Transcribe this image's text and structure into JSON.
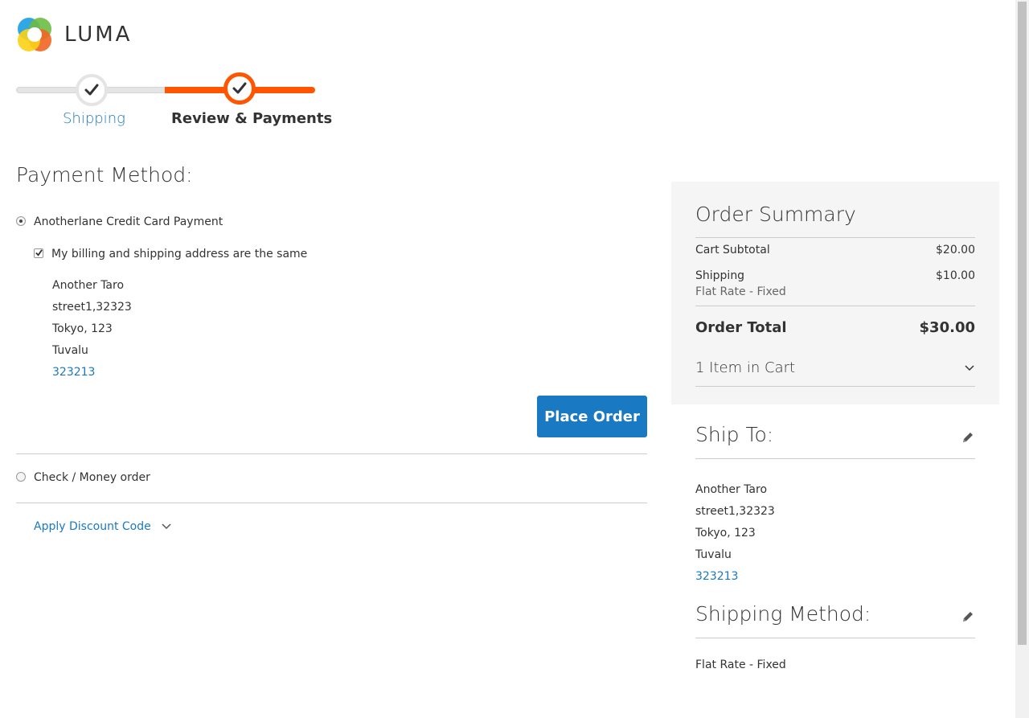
{
  "logo": {
    "text": "LUMA"
  },
  "progress": {
    "steps": [
      {
        "label": "Shipping",
        "state": "complete"
      },
      {
        "label": "Review & Payments",
        "state": "active"
      }
    ]
  },
  "payment": {
    "title": "Payment Method:",
    "options": [
      {
        "label": "Anotherlane Credit Card Payment",
        "selected": true
      },
      {
        "label": "Check / Money order",
        "selected": false
      }
    ],
    "same_address_label": "My billing and shipping address are the same",
    "billing_address": {
      "name": "Another Taro",
      "street": "street1,32323",
      "city": "Tokyo, 123",
      "country": "Tuvalu",
      "phone": "323213"
    },
    "place_order_label": "Place Order",
    "discount_label": "Apply Discount Code"
  },
  "summary": {
    "title": "Order Summary",
    "subtotal_label": "Cart Subtotal",
    "subtotal_value": "$20.00",
    "shipping_label": "Shipping",
    "shipping_value": "$10.00",
    "shipping_method": "Flat Rate - Fixed",
    "total_label": "Order Total",
    "total_value": "$30.00",
    "items_label": "1 Item in Cart"
  },
  "ship_to": {
    "title": "Ship To:",
    "name": "Another Taro",
    "street": "street1,32323",
    "city": "Tokyo, 123",
    "country": "Tuvalu",
    "phone": "323213"
  },
  "shipping_method": {
    "title": "Shipping Method:",
    "value": "Flat Rate - Fixed"
  },
  "colors": {
    "accent": "#1979c3",
    "progress": "#ff5501"
  }
}
